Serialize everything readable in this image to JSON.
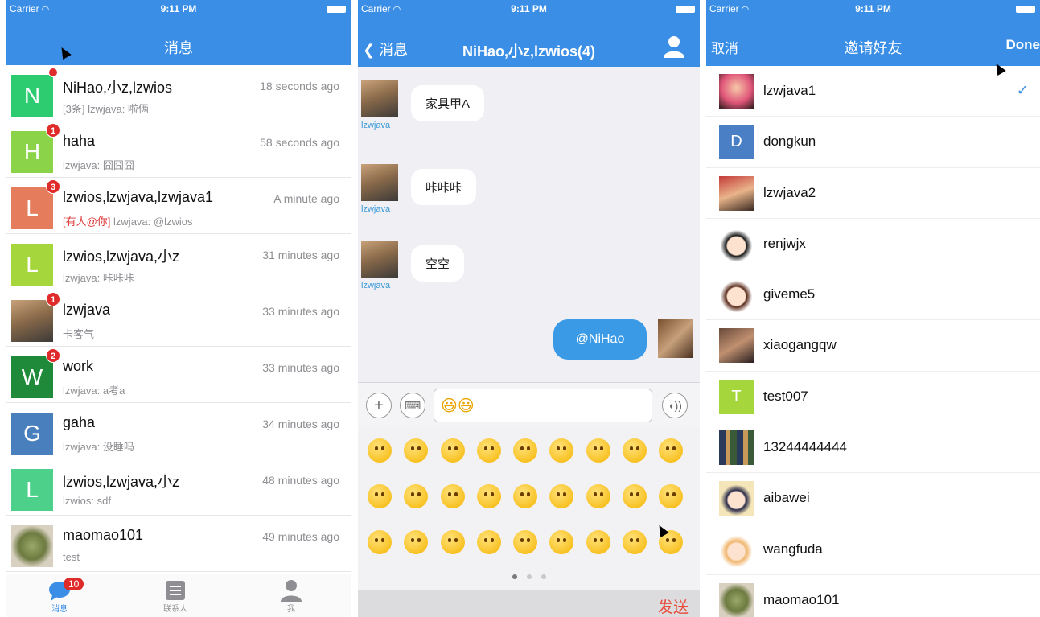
{
  "status": {
    "carrier": "Carrier",
    "time": "9:11 PM"
  },
  "messages_screen": {
    "title": "消息",
    "conversations": [
      {
        "avatar_letter": "N",
        "avatar_color": "#2ecc71",
        "badge": "",
        "dot": true,
        "name": "NiHao,小z,lzwios",
        "time": "18 seconds ago",
        "mention": "",
        "preview": "[3条] lzwjava: 啦俩"
      },
      {
        "avatar_letter": "H",
        "avatar_color": "#8bd44a",
        "badge": "1",
        "dot": false,
        "name": "haha",
        "time": "58 seconds ago",
        "mention": "",
        "preview": "lzwjava: 囧囧囧"
      },
      {
        "avatar_letter": "L",
        "avatar_color": "#e57c5b",
        "badge": "3",
        "dot": false,
        "name": "lzwios,lzwjava,lzwjava1",
        "time": "A minute ago",
        "mention": "[有人@你]",
        "preview": " lzwjava: @lzwios"
      },
      {
        "avatar_letter": "L",
        "avatar_color": "#a5d63b",
        "badge": "",
        "dot": false,
        "name": "lzwios,lzwjava,小z",
        "time": "31 minutes ago",
        "mention": "",
        "preview": "lzwjava: 咔咔咔"
      },
      {
        "avatar_letter": "",
        "avatar_color": "",
        "badge": "1",
        "dot": false,
        "name": "lzwjava",
        "time": "33 minutes ago",
        "mention": "",
        "preview": "卡客气"
      },
      {
        "avatar_letter": "W",
        "avatar_color": "#1e8a3a",
        "badge": "2",
        "dot": false,
        "name": "work",
        "time": "33 minutes ago",
        "mention": "",
        "preview": "lzwjava: a考a"
      },
      {
        "avatar_letter": "G",
        "avatar_color": "#4a7fbd",
        "badge": "",
        "dot": false,
        "name": "gaha",
        "time": "34 minutes ago",
        "mention": "",
        "preview": "lzwjava: 没睡吗"
      },
      {
        "avatar_letter": "L",
        "avatar_color": "#4cd08a",
        "badge": "",
        "dot": false,
        "name": "lzwios,lzwjava,小z",
        "time": "48 minutes ago",
        "mention": "",
        "preview": "lzwios: sdf"
      },
      {
        "avatar_letter": "",
        "avatar_color": "",
        "badge": "",
        "dot": false,
        "name": "maomao101",
        "time": "49 minutes ago",
        "mention": "",
        "preview": "test"
      }
    ],
    "tabbar": {
      "messages_label": "消息",
      "messages_badge": "10",
      "contacts_label": "联系人",
      "me_label": "我"
    }
  },
  "chat_screen": {
    "back_label": "消息",
    "title": "NiHao,小z,lzwios(4)",
    "messages": [
      {
        "sender": "lzwjava",
        "text": "家具甲A"
      },
      {
        "sender": "lzwjava",
        "text": "咔咔咔"
      },
      {
        "sender": "lzwjava",
        "text": "空空"
      }
    ],
    "outgoing": {
      "text": "@NiHao"
    },
    "input_text": "😃😃",
    "send_label": "发送"
  },
  "invite_screen": {
    "cancel_label": "取消",
    "title": "邀请好友",
    "done_label": "Done",
    "friends": [
      {
        "name": "lzwjava1",
        "checked": true
      },
      {
        "name": "dongkun",
        "letter": "D",
        "color": "#4a7fc6"
      },
      {
        "name": "lzwjava2"
      },
      {
        "name": "renjwjx"
      },
      {
        "name": "giveme5"
      },
      {
        "name": "xiaogangqw"
      },
      {
        "name": "test007",
        "letter": "T",
        "color": "#a5d63b"
      },
      {
        "name": "13244444444"
      },
      {
        "name": "aibawei"
      },
      {
        "name": "wangfuda"
      },
      {
        "name": "maomao101"
      }
    ]
  }
}
